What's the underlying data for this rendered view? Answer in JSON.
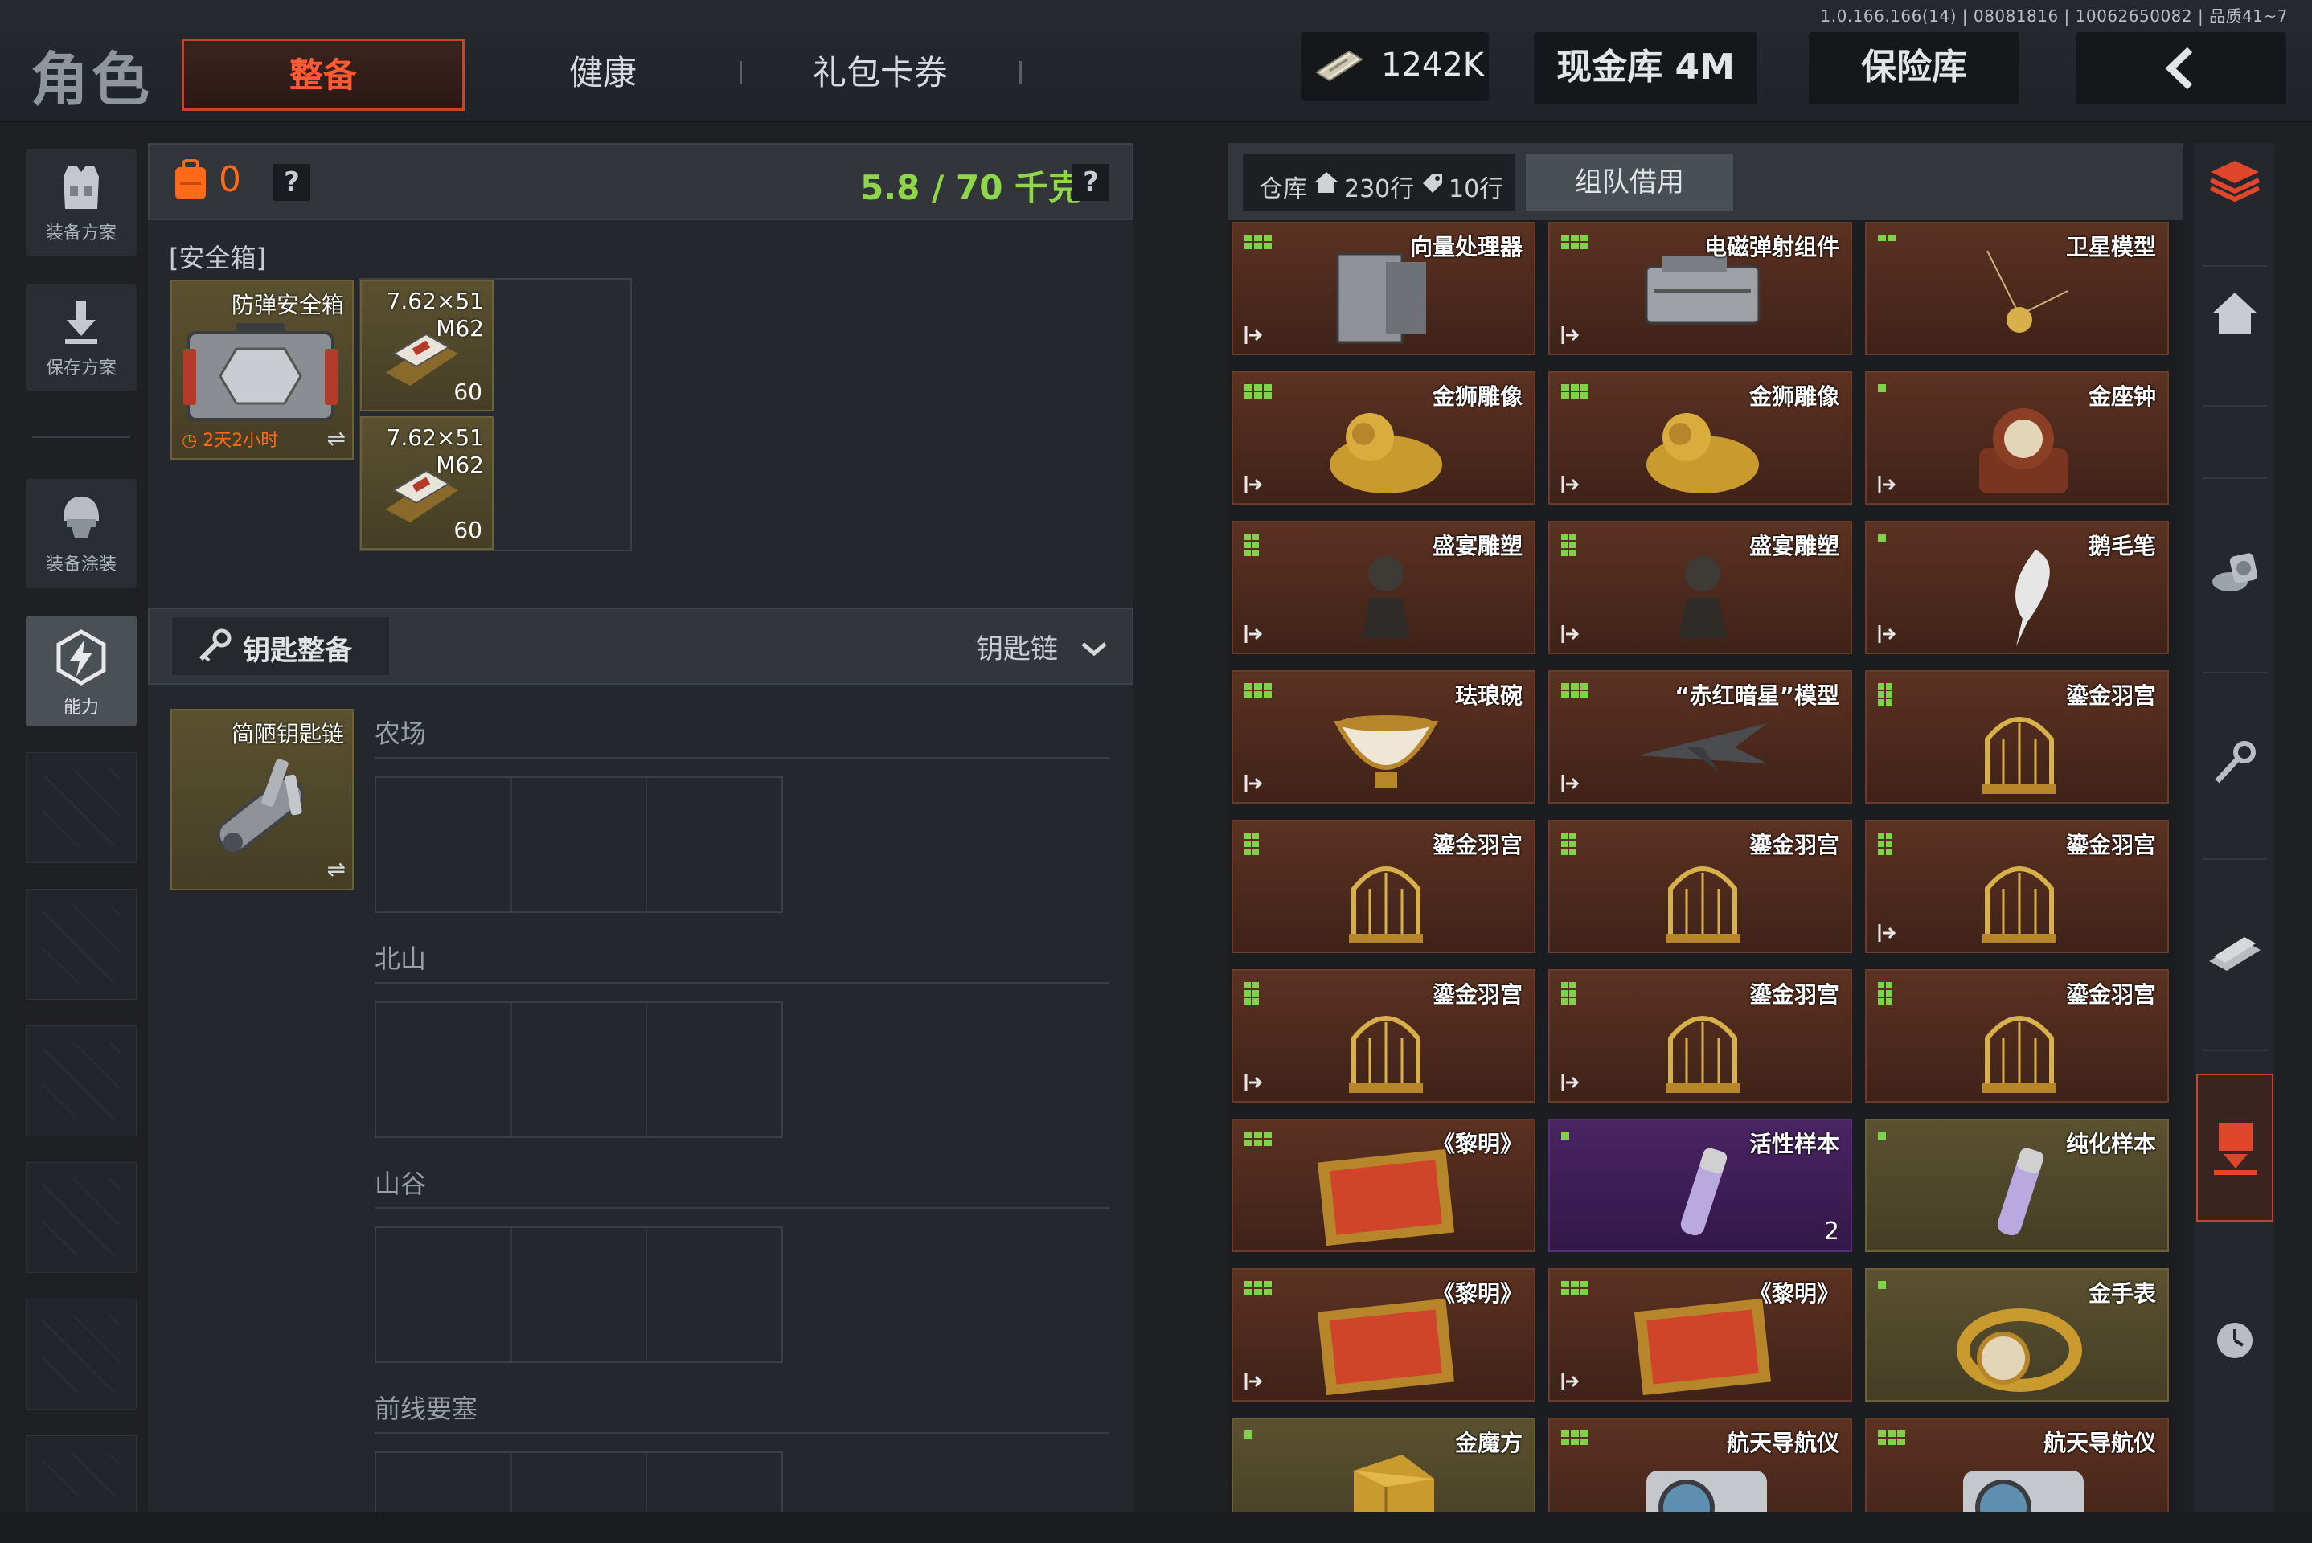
{
  "version": "1.0.166.166(14) | 08081816 | 10062650082 | 品质41~7",
  "header": {
    "title": "角色",
    "tabs": [
      {
        "label": "整备",
        "active": true
      },
      {
        "label": "健康",
        "active": false
      },
      {
        "label": "礼包卡券",
        "active": false
      }
    ],
    "money": "1242K",
    "cash_vault": "现金库 4M",
    "safe_vault": "保险库"
  },
  "left_nav": {
    "items": [
      {
        "label": "装备方案",
        "icon": "vest-icon"
      },
      {
        "label": "保存方案",
        "icon": "download-icon"
      },
      {
        "label": "装备涂装",
        "icon": "helmet-icon"
      },
      {
        "label": "能力",
        "icon": "ability-icon",
        "active": true
      }
    ]
  },
  "loadout": {
    "bag_count": "0",
    "help": "?",
    "weight": "5.8 / 70 千克",
    "safe_box_label": "安全箱",
    "safe_box": {
      "name": "防弹安全箱",
      "timer": "2天2小时"
    },
    "ammo": [
      {
        "name": "7.62×51\nM62",
        "count": "60"
      },
      {
        "name": "7.62×51\nM62",
        "count": "60"
      }
    ],
    "key_section": {
      "title": "钥匙整备",
      "dropdown": "钥匙链",
      "keychain": "简陋钥匙链",
      "maps": [
        "农场",
        "北山",
        "山谷",
        "前线要塞"
      ]
    }
  },
  "warehouse": {
    "tab_label": "仓库",
    "rows_home": "230行",
    "rows_tag": "10行",
    "team_borrow": "组队借用",
    "items": [
      {
        "name": "向量处理器",
        "bg": "brown",
        "icon": "server-icon",
        "dots": 3,
        "exit": true
      },
      {
        "name": "电磁弹射组件",
        "bg": "brown",
        "icon": "engine-icon",
        "dots": 3,
        "exit": true
      },
      {
        "name": "卫星模型",
        "bg": "brown",
        "icon": "satellite-icon",
        "dots": 2,
        "exit": false
      },
      {
        "name": "金狮雕像",
        "bg": "brown",
        "icon": "lion-icon",
        "dots": 3,
        "exit": true
      },
      {
        "name": "金狮雕像",
        "bg": "brown",
        "icon": "lion-icon",
        "dots": 3,
        "exit": true
      },
      {
        "name": "金座钟",
        "bg": "brown",
        "icon": "clock-icon",
        "dots": 1,
        "exit": true
      },
      {
        "name": "盛宴雕塑",
        "bg": "brown",
        "icon": "bust-icon",
        "dots": 4,
        "exit": true
      },
      {
        "name": "盛宴雕塑",
        "bg": "brown",
        "icon": "bust-icon",
        "dots": 4,
        "exit": true
      },
      {
        "name": "鹅毛笔",
        "bg": "brown",
        "icon": "quill-icon",
        "dots": 1,
        "exit": true
      },
      {
        "name": "珐琅碗",
        "bg": "brown",
        "icon": "bowl-icon",
        "dots": 3,
        "exit": true
      },
      {
        "name": "“赤红暗星”模型",
        "bg": "brown",
        "icon": "jet-icon",
        "dots": 3,
        "exit": true
      },
      {
        "name": "鎏金羽宫",
        "bg": "brown",
        "icon": "birdcage-icon",
        "dots": 4,
        "exit": false
      },
      {
        "name": "鎏金羽宫",
        "bg": "brown",
        "icon": "birdcage-icon",
        "dots": 4,
        "exit": false
      },
      {
        "name": "鎏金羽宫",
        "bg": "brown",
        "icon": "birdcage-icon",
        "dots": 4,
        "exit": false
      },
      {
        "name": "鎏金羽宫",
        "bg": "brown",
        "icon": "birdcage-icon",
        "dots": 4,
        "exit": true
      },
      {
        "name": "鎏金羽宫",
        "bg": "brown",
        "icon": "birdcage-icon",
        "dots": 4,
        "exit": true
      },
      {
        "name": "鎏金羽宫",
        "bg": "brown",
        "icon": "birdcage-icon",
        "dots": 4,
        "exit": true
      },
      {
        "name": "鎏金羽宫",
        "bg": "brown",
        "icon": "birdcage-icon",
        "dots": 4,
        "exit": false
      },
      {
        "name": "《黎明》",
        "bg": "brown",
        "icon": "painting-icon",
        "dots": 3,
        "exit": false
      },
      {
        "name": "活性样本",
        "bg": "purple",
        "icon": "vial-icon",
        "dots": 1,
        "exit": false,
        "count": "2"
      },
      {
        "name": "纯化样本",
        "bg": "olive",
        "icon": "vial-icon",
        "dots": 1,
        "exit": false
      },
      {
        "name": "《黎明》",
        "bg": "brown",
        "icon": "painting-icon",
        "dots": 3,
        "exit": true
      },
      {
        "name": "《黎明》",
        "bg": "brown",
        "icon": "painting-icon",
        "dots": 3,
        "exit": true
      },
      {
        "name": "金手表",
        "bg": "olive",
        "icon": "watch-icon",
        "dots": 1,
        "exit": false
      },
      {
        "name": "金魔方",
        "bg": "olive",
        "icon": "cube-icon",
        "dots": 1,
        "exit": false
      },
      {
        "name": "航天导航仪",
        "bg": "brown",
        "icon": "navigator-icon",
        "dots": 3,
        "exit": false
      },
      {
        "name": "航天导航仪",
        "bg": "brown",
        "icon": "navigator-icon",
        "dots": 3,
        "exit": false
      }
    ]
  },
  "right_nav": [
    "stack-icon",
    "home-icon",
    "coins-icon",
    "key-icon",
    "cash-icon",
    "deposit-icon",
    "clock-icon"
  ],
  "colors": {
    "accent": "#c4442e",
    "weight_green": "#8fd64a",
    "bag_orange": "#ff6a1a",
    "dot_green": "#7fd34a"
  }
}
